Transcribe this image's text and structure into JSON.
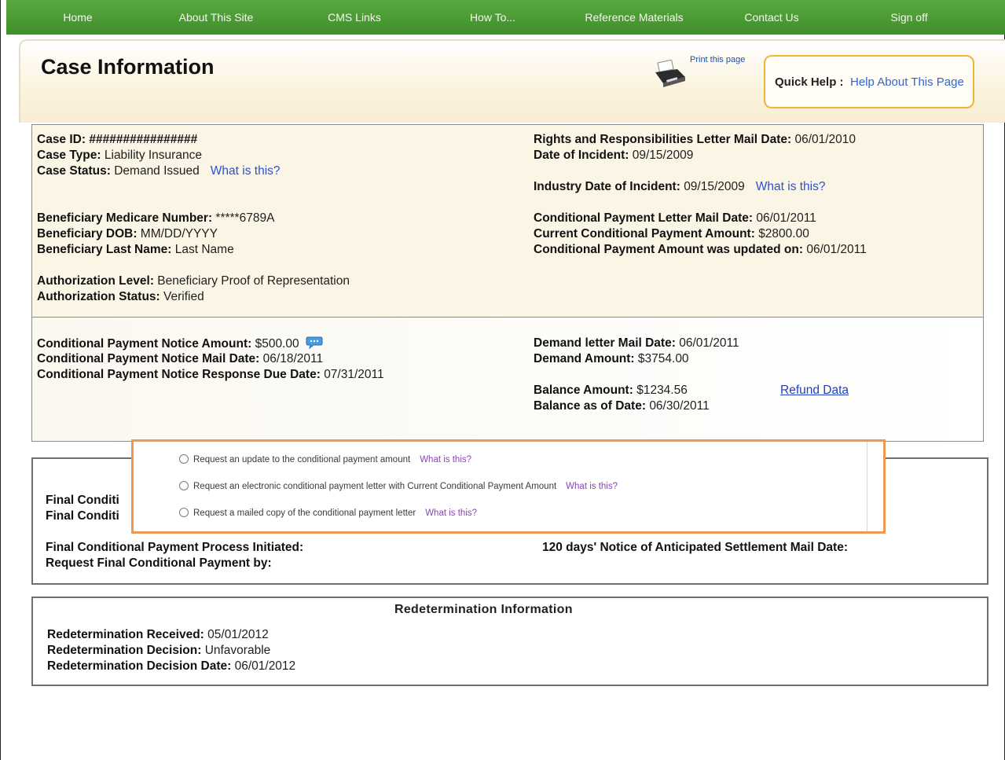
{
  "nav": {
    "items": [
      {
        "label": "Home"
      },
      {
        "label": "About This Site"
      },
      {
        "label": "CMS Links"
      },
      {
        "label": "How To..."
      },
      {
        "label": "Reference Materials"
      },
      {
        "label": "Contact Us"
      },
      {
        "label": "Sign off"
      }
    ]
  },
  "header": {
    "title": "Case Information",
    "print_label": "Print this page",
    "quick_help_label": "Quick Help :",
    "quick_help_link": "Help About This Page"
  },
  "case": {
    "id_label": "Case ID:",
    "id_value": "################",
    "type_label": "Case Type:",
    "type_value": "Liability Insurance",
    "status_label": "Case Status:",
    "status_value": "Demand Issued",
    "what_is_this": "What is this?",
    "bene_num_label": "Beneficiary Medicare Number:",
    "bene_num_value": "*****6789A",
    "bene_dob_label": "Beneficiary DOB:",
    "bene_dob_value": "MM/DD/YYYY",
    "bene_last_label": "Beneficiary Last Name:",
    "bene_last_value": "Last Name",
    "auth_level_label": "Authorization Level:",
    "auth_level_value": "Beneficiary Proof of Representation",
    "auth_status_label": "Authorization Status:",
    "auth_status_value": "Verified",
    "rr_label": "Rights and Responsibilities Letter Mail Date:",
    "rr_value": "06/01/2010",
    "doi_label": "Date of Incident:",
    "doi_value": "09/15/2009",
    "idoi_label": "Industry Date of Incident:",
    "idoi_value": "09/15/2009",
    "cpl_label": "Conditional Payment Letter Mail Date:",
    "cpl_value": "06/01/2011",
    "ccpa_label": "Current Conditional Payment Amount:",
    "ccpa_value": "$2800.00",
    "cpau_label": "Conditional Payment Amount was updated on:",
    "cpau_value": "06/01/2011"
  },
  "notice": {
    "cpna_label": "Conditional Payment Notice Amount:",
    "cpna_value": "$500.00",
    "cpnm_label": "Conditional Payment Notice Mail Date:",
    "cpnm_value": "06/18/2011",
    "cpnr_label": "Conditional Payment Notice Response Due Date:",
    "cpnr_value": "07/31/2011",
    "dlm_label": "Demand letter Mail Date:",
    "dlm_value": "06/01/2011",
    "da_label": "Demand Amount:",
    "da_value": "$3754.00",
    "ba_label": "Balance Amount:",
    "ba_value": "$1234.56",
    "bad_label": "Balance as of Date:",
    "bad_value": "06/30/2011",
    "refund_link": "Refund Data"
  },
  "final": {
    "partial1": "Final Conditi",
    "partial2": "Final Conditi",
    "process_label": "Final Conditional Payment Process Initiated:",
    "request_label": "Request Final Conditional Payment by:",
    "notice_label": "120 days' Notice of Anticipated Settlement Mail Date:"
  },
  "options": {
    "opt1": "Request an update to the conditional payment amount",
    "opt2": "Request an electronic conditional payment letter with Current Conditional Payment Amount",
    "opt3": "Request a mailed copy of the conditional payment letter",
    "what_is_this": "What is this?"
  },
  "redetermination": {
    "title": "Redetermination Information",
    "received_label": "Redetermination Received:",
    "received_value": "05/01/2012",
    "decision_label": "Redetermination Decision:",
    "decision_value": "Unfavorable",
    "decision_date_label": "Redetermination Decision Date:",
    "decision_date_value": "06/01/2012"
  }
}
